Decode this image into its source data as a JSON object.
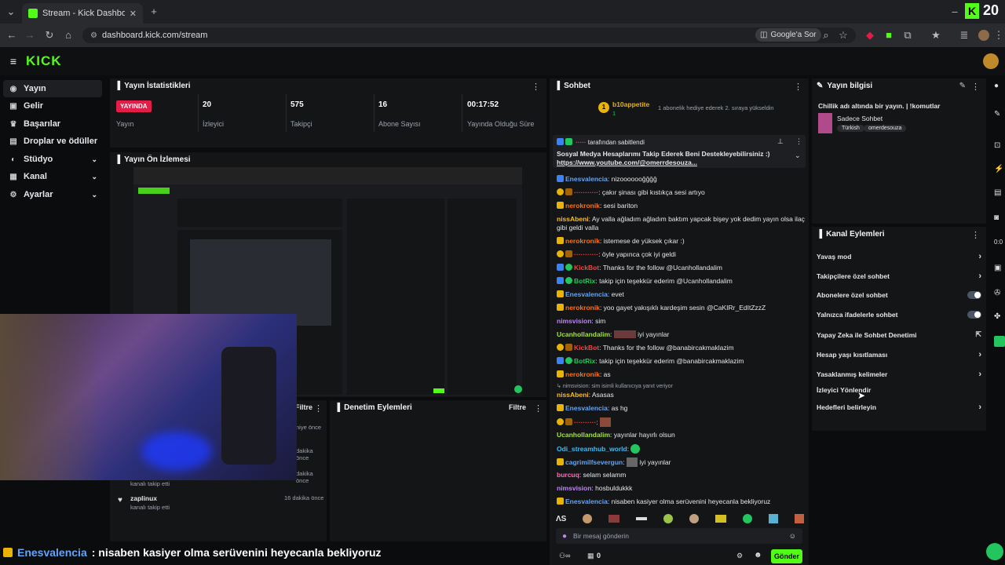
{
  "browser": {
    "tab_title": "Stream - Kick Dashboard",
    "url": "dashboard.kick.com/stream",
    "ask_google": "Google'a Sor",
    "corner_text": "20"
  },
  "kick": {
    "logo": "KICK"
  },
  "sidebar": {
    "items": [
      {
        "label": "Yayın",
        "icon": "broadcast-icon"
      },
      {
        "label": "Gelir",
        "icon": "wallet-icon"
      },
      {
        "label": "Başarılar",
        "icon": "trophy-icon"
      },
      {
        "label": "Droplar ve ödüller",
        "icon": "gift-icon"
      },
      {
        "label": "Stüdyo",
        "icon": "studio-icon"
      },
      {
        "label": "Kanal",
        "icon": "channel-icon"
      },
      {
        "label": "Ayarlar",
        "icon": "settings-icon"
      }
    ]
  },
  "stats": {
    "title": "Yayın İstatistikleri",
    "live": "YAYINDA",
    "items": [
      {
        "value": "",
        "label": "Yayın"
      },
      {
        "value": "20",
        "label": "İzleyici"
      },
      {
        "value": "575",
        "label": "Takipçi"
      },
      {
        "value": "16",
        "label": "Abone Sayısı"
      },
      {
        "value": "00:17:52",
        "label": "Yayında Olduğu Süre"
      }
    ]
  },
  "preview": {
    "title": "Yayın Ön İzlemesi"
  },
  "mod_actions": {
    "title": "Denetim Eylemleri",
    "filter": "Filtre"
  },
  "activity": {
    "filter": "Filtre",
    "times": [
      "niye önce",
      "dakika önce",
      "dakika önce"
    ],
    "rows": [
      {
        "user": "zaplinux",
        "text": "kanalı takip etti",
        "time": "16 dakika önce"
      }
    ],
    "partial_text": "kanalı takip etti"
  },
  "chat": {
    "title": "Sohbet",
    "gifter": "b10appetite",
    "gifter_count": "1",
    "gift_text": "1 abonelik hediye ederek 2. sıraya yükseldin",
    "pinned_by": "tarafından sabitlendi",
    "pinned_text": "Sosyal Medya Hesaplarımı Takip Ederek Beni Destekleyebilirsiniz :)",
    "pinned_link": "https://www.youtube.com/@omerrdesouza...",
    "messages": [
      {
        "user": "Enesvalencia",
        "color": "#60a5fa",
        "text": "nizooooooğğğğ"
      },
      {
        "user": "",
        "color": "#ef4444",
        "text": "çakır şinası gibi kıstıkça sesi artıyo"
      },
      {
        "user": "nerokronik",
        "color": "#f97316",
        "text": "sesi bariton"
      },
      {
        "user": "nissAbeni",
        "color": "#fbbf24",
        "text": "Ay valla ağladım ağladım baktım yapcak bişey yok dedim yayın olsa ilaç gibi geldi valla"
      },
      {
        "user": "nerokronik",
        "color": "#f97316",
        "text": "istemese de yüksek çıkar :)"
      },
      {
        "user": "",
        "color": "#ef4444",
        "text": "öyle yapınca çok iyi geldi"
      },
      {
        "user": "KickBot",
        "color": "#ef4444",
        "text": "Thanks for the follow @Ucanhollandalim"
      },
      {
        "user": "BotRix",
        "color": "#22c55e",
        "text": "takip için teşekkür ederim @Ucanhollandalim"
      },
      {
        "user": "Enesvalencia",
        "color": "#60a5fa",
        "text": "evet"
      },
      {
        "user": "nerokronik",
        "color": "#f97316",
        "text": "yoo gayet yakışıklı kardeşim sesin @CaKIRr_EdItZzzZ"
      },
      {
        "user": "nimsvision",
        "color": "#c084fc",
        "text": "sim"
      },
      {
        "user": "Ucanhollandalim",
        "color": "#a3e635",
        "text": "iyi yayınlar"
      },
      {
        "user": "KickBot",
        "color": "#ef4444",
        "text": "Thanks for the follow @banabircakmaklazim"
      },
      {
        "user": "BotRix",
        "color": "#22c55e",
        "text": "takip için teşekkür ederim @banabircakmaklazim"
      },
      {
        "user": "nerokronik",
        "color": "#f97316",
        "text": "as"
      },
      {
        "user": "nissAbeni",
        "color": "#fbbf24",
        "text": "Asasas"
      },
      {
        "user": "Enesvalencia",
        "color": "#60a5fa",
        "text": "as hg"
      },
      {
        "user": "",
        "color": "#ef4444",
        "text": ""
      },
      {
        "user": "Ucanhollandalim",
        "color": "#a3e635",
        "text": "yayınlar hayırlı olsun"
      },
      {
        "user": "Odi_streamhub_world",
        "color": "#38bdf8",
        "text": ""
      },
      {
        "user": "cagrimilfsevergun",
        "color": "#60a5fa",
        "text": "iyi yayınlar"
      },
      {
        "user": "burcuq",
        "color": "#f472b6",
        "text": "selam selamm"
      },
      {
        "user": "nimsvision",
        "color": "#c084fc",
        "text": "hosbuldukkk"
      },
      {
        "user": "Enesvalencia",
        "color": "#60a5fa",
        "text": "nisaben kasiyer olma serüvenini heyecanla bekliyoruz"
      }
    ],
    "reply_note": "nimsvision: sim isimli kullanıcıya yanıt veriyor",
    "input_placeholder": "Bir mesaj gönderin",
    "viewer_count": "0",
    "send": "Gönder"
  },
  "stream_info": {
    "title": "Yayın bilgisi",
    "stream_title": "Chillik adı altında bir yayın. | !komutlar",
    "category": "Sadece Sohbet",
    "tags": [
      "Türkish",
      "omerdesouza"
    ]
  },
  "channel_actions": {
    "title": "Kanal Eylemleri",
    "items": [
      {
        "label": "Yavaş mod",
        "control": "arrow"
      },
      {
        "label": "Takipçilere özel sohbet",
        "control": "arrow"
      },
      {
        "label": "Abonelere özel sohbet",
        "control": "toggle"
      },
      {
        "label": "Yalnızca ifadelerle sohbet",
        "control": "toggle"
      },
      {
        "label": "Yapay Zeka ile Sohbet Denetimi",
        "control": "external"
      },
      {
        "label": "Hesap yaşı kısıtlaması",
        "control": "arrow"
      },
      {
        "label": "Yasaklanmış kelimeler",
        "control": "arrow"
      },
      {
        "label": "İzleyici Yönlendir",
        "control": "none"
      },
      {
        "label": "Hedefleri belirleyin",
        "control": "arrow"
      }
    ]
  },
  "ticker": {
    "user": "Enesvalencia",
    "text": ": nisaben kasiyer olma serüvenini heyecanla bekliyoruz"
  }
}
